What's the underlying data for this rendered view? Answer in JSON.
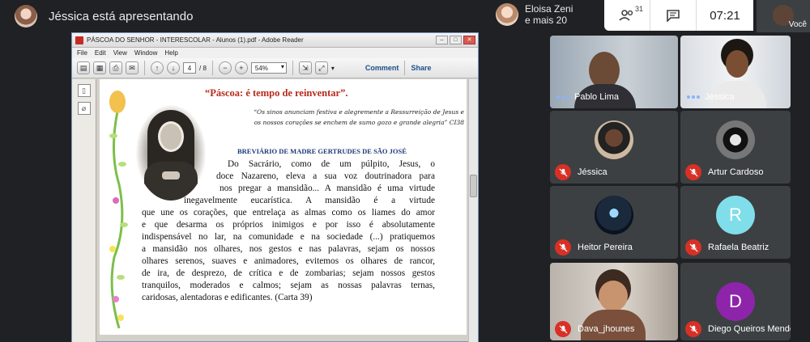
{
  "presenter": {
    "title": "Jéssica está apresentando"
  },
  "top": {
    "others_name": "Eloisa Zeni",
    "others_more": "e mais 20",
    "people_count": "31",
    "clock": "07:21",
    "self_label": "Você"
  },
  "reader": {
    "window_title": "PÁSCOA DO SENHOR - INTERESCOLAR - Alunos (1).pdf - Adobe Reader",
    "menu": [
      "File",
      "Edit",
      "View",
      "Window",
      "Help"
    ],
    "page_current": "4",
    "page_total": "/ 8",
    "zoom": "54%",
    "comment": "Comment",
    "share": "Share"
  },
  "doc": {
    "title": "“Páscoa: é tempo de reinventar”.",
    "quote_1": "“Os sinos anunciam festiva e alegremente a Ressurreição de Jesus e",
    "quote_2": "os nossos corações se enchem de sumo gozo e grande alegria” CI38",
    "subtitle": "BREVIÁRIO DE MADRE GERTRUDES DE SÃO JOSÉ",
    "lines": [
      "Do Sacrário, como de um púlpito, Jesus, o",
      "doce Nazareno, eleva a sua voz doutrinadora para",
      "nos pregar a mansidão... A mansidão é uma virtude",
      "inegavelmente eucarística. A mansidão é a virtude",
      "que une os corações, que entrelaça as almas como os liames do amor",
      "e que desarma os próprios inimigos e por isso é absolutamente",
      "indispensável no lar, na comunidade e na sociedade (...) pratiquemos",
      "a mansidão nos olhares, nos gestos e nas palavras, sejam os nossos",
      "olhares serenos, suaves e animadores, evitemos os olhares de rancor,",
      "de ira, de desprezo, de crítica e de zombarias; sejam nossos gestos",
      "tranquilos, moderados e calmos; sejam as nossas palavras ternas,",
      "caridosas, alentadoras e edificantes. (Carta 39)"
    ]
  },
  "participants": [
    {
      "name": "Pablo Lima",
      "muted": false
    },
    {
      "name": "Jéssica",
      "muted": false
    },
    {
      "name": "Jéssica",
      "muted": true
    },
    {
      "name": "Artur Cardoso",
      "muted": true
    },
    {
      "name": "Heitor Pereira",
      "muted": true
    },
    {
      "name": "Rafaela Beatriz",
      "muted": true,
      "initial": "R",
      "color": "#80deea"
    },
    {
      "name": "Dava_jhounes",
      "muted": true
    },
    {
      "name": "Diego Queiros Mendes",
      "muted": true,
      "initial": "D",
      "color": "#8e24aa"
    }
  ]
}
